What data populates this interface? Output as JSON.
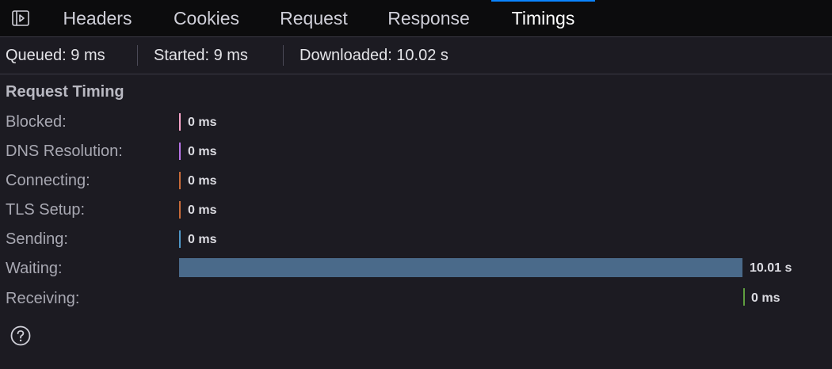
{
  "tabs": [
    {
      "label": "Headers"
    },
    {
      "label": "Cookies"
    },
    {
      "label": "Request"
    },
    {
      "label": "Response"
    },
    {
      "label": "Timings",
      "selected": true
    }
  ],
  "summary": {
    "queued": "Queued: 9 ms",
    "started": "Started: 9 ms",
    "downloaded": "Downloaded: 10.02 s"
  },
  "request_timing": {
    "title": "Request Timing",
    "rows": [
      {
        "label": "Blocked:",
        "value": "0 ms",
        "color": "#f5a3c8"
      },
      {
        "label": "DNS Resolution:",
        "value": "0 ms",
        "color": "#b874e6"
      },
      {
        "label": "Connecting:",
        "value": "0 ms",
        "color": "#c76b3a"
      },
      {
        "label": "TLS Setup:",
        "value": "0 ms",
        "color": "#c76b3a"
      },
      {
        "label": "Sending:",
        "value": "0 ms",
        "color": "#4f97c7"
      },
      {
        "label": "Waiting:",
        "value": "10.01 s",
        "color": "#4a6a8a"
      },
      {
        "label": "Receiving:",
        "value": "0 ms",
        "color": "#5f9e3f"
      }
    ]
  },
  "icons": {
    "sidebar_toggle": "sidebar-toggle-icon",
    "help": "help-icon"
  }
}
